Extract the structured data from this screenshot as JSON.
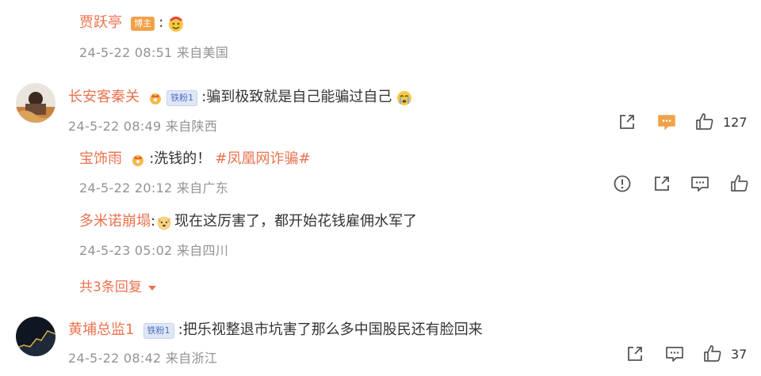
{
  "comments": [
    {
      "user": "贾跃亭",
      "badge": "博主",
      "text": "",
      "time": "24-5-22 08:51 来自美国"
    },
    {
      "user": "长安客秦关",
      "badge": "铁粉1",
      "text": ":骗到极致就是自己能骗过自己",
      "time": "24-5-22 08:49 来自陕西",
      "likes": "127",
      "replies": [
        {
          "user": "宝饰雨",
          "text_prefix": ":洗钱的！",
          "tag": "#凤凰网诈骗#",
          "time": "24-5-22 20:12 来自广东"
        },
        {
          "user": "多米诺崩塌",
          "text": "现在这厉害了，都开始花钱雇佣水军了",
          "time": "24-5-23 05:02 来自四川"
        }
      ],
      "more_replies": "共3条回复"
    },
    {
      "user": "黄埔总监1",
      "badge": "铁粉1",
      "text": ":把乐视整退市坑害了那么多中国股民还有脸回来",
      "time": "24-5-22 08:42 来自浙江",
      "likes": "37"
    }
  ],
  "icons": {
    "share": "share-icon",
    "comment": "comment-icon",
    "like": "thumbs-up-icon",
    "report": "report-icon"
  },
  "colors": {
    "username": "#eb7350",
    "meta": "#939393",
    "accent": "#f0a24a",
    "icon": "#555555"
  }
}
